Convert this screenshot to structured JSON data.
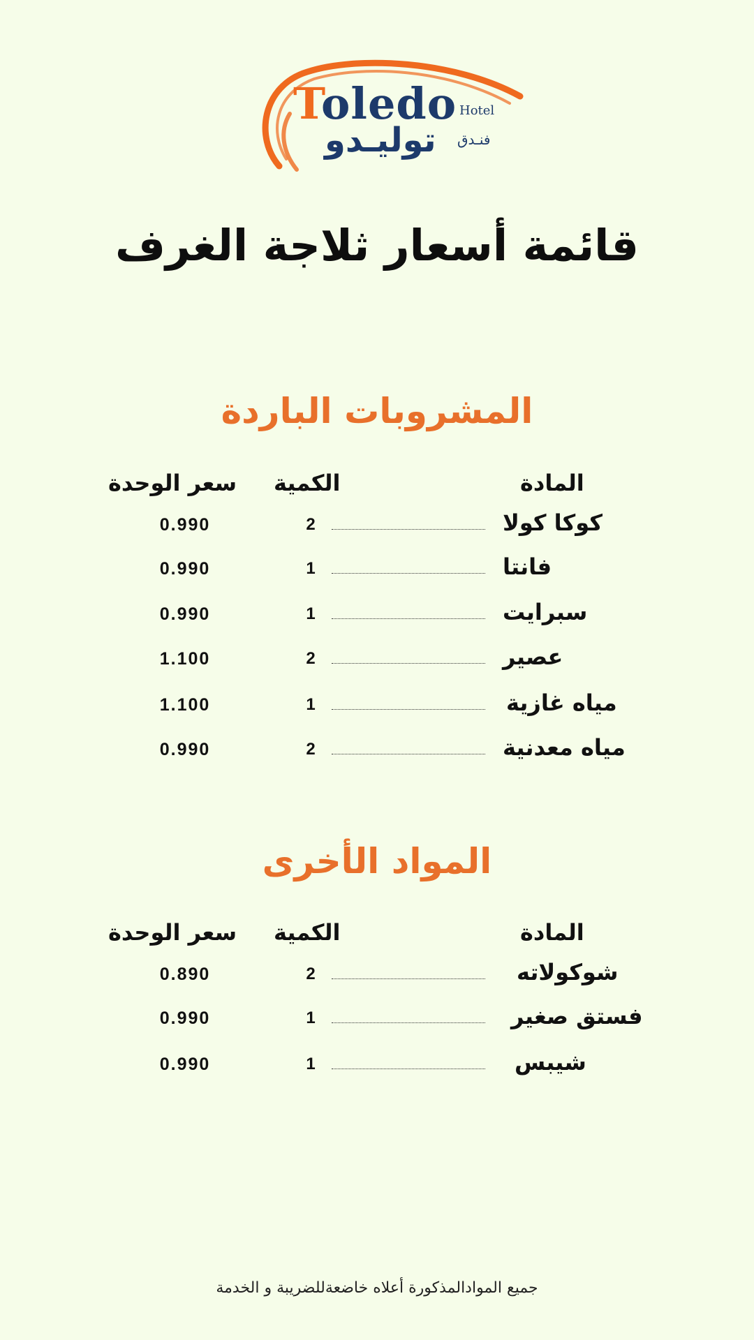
{
  "logo": {
    "latin_first": "T",
    "latin_rest": "oledo",
    "hotel": "Hotel",
    "arabic": "توليـدو",
    "arabic_small": "فنـدق",
    "brush_color": "#ef6a1f",
    "text_color": "#1d3a6b"
  },
  "title": "قائمة أسعار ثلاجة الغرف",
  "sections": [
    {
      "title": "المشروبات الباردة",
      "headers": {
        "item": "المادة",
        "qty": "الكمية",
        "price": "سعر الوحدة"
      },
      "rows": [
        {
          "item": "كوكا كولا",
          "qty": "2",
          "price": "0.990"
        },
        {
          "item": "فانتا",
          "qty": "1",
          "price": "0.990"
        },
        {
          "item": "سبرايت",
          "qty": "1",
          "price": "0.990"
        },
        {
          "item": "عصير",
          "qty": "2",
          "price": "1.100"
        },
        {
          "item": "مياه غازية",
          "qty": "1",
          "price": "1.100"
        },
        {
          "item": "مياه معدنية",
          "qty": "2",
          "price": "0.990"
        }
      ]
    },
    {
      "title": "المواد الأخرى",
      "headers": {
        "item": "المادة",
        "qty": "الكمية",
        "price": "سعر الوحدة"
      },
      "rows": [
        {
          "item": "شوكولاته",
          "qty": "2",
          "price": "0.890"
        },
        {
          "item": "فستق صغير",
          "qty": "1",
          "price": "0.990"
        },
        {
          "item": "شيبس",
          "qty": "1",
          "price": "0.990"
        }
      ]
    }
  ],
  "footer": "جميع الموادالمذكورة أعلاه خاضعةللضريبة و الخدمة",
  "colors": {
    "background": "#f6fde9",
    "accent": "#e8702b",
    "text": "#111111"
  }
}
